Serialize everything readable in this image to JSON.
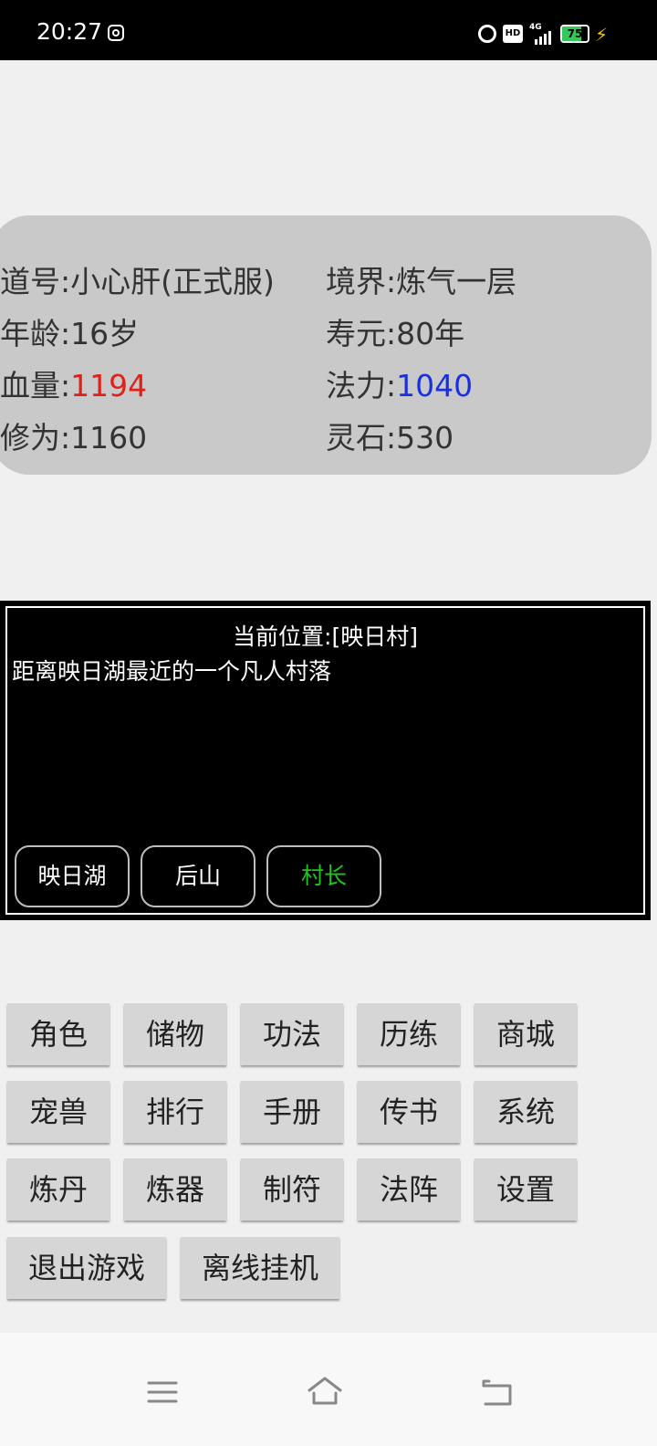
{
  "status_bar": {
    "time": "20:27",
    "hd": "HD",
    "network": "4G",
    "battery_level": 75,
    "battery_text": "75"
  },
  "player": {
    "name_label": "道号:",
    "name": "小心肝(正式服)",
    "realm_label": "境界:",
    "realm": "炼气一层",
    "age_label": "年龄:",
    "age": "16岁",
    "lifespan_label": "寿元:",
    "lifespan": "80年",
    "hp_label": "血量:",
    "hp": "1194",
    "mp_label": "法力:",
    "mp": "1040",
    "cultivation_label": "修为:",
    "cultivation": "1160",
    "spirit_stone_label": "灵石:",
    "spirit_stone": "530",
    "colors": {
      "hp": "#e0201a",
      "mp": "#1a2fe0"
    }
  },
  "location": {
    "title": "当前位置:[映日村]",
    "description": "距离映日湖最近的一个凡人村落",
    "actions": [
      {
        "label": "映日湖",
        "color": "#ffffff"
      },
      {
        "label": "后山",
        "color": "#ffffff"
      },
      {
        "label": "村长",
        "color": "#1dc51d"
      }
    ]
  },
  "menu": {
    "row1": [
      "角色",
      "储物",
      "功法",
      "历练",
      "商城"
    ],
    "row2": [
      "宠兽",
      "排行",
      "手册",
      "传书",
      "系统"
    ],
    "row3": [
      "炼丹",
      "炼器",
      "制符",
      "法阵",
      "设置"
    ],
    "row4": [
      "退出游戏",
      "离线挂机"
    ]
  },
  "nav": {
    "icons": [
      "menu-icon",
      "home-icon",
      "back-icon"
    ]
  }
}
